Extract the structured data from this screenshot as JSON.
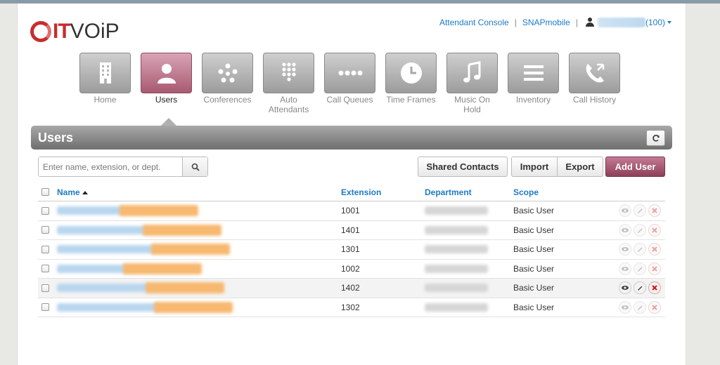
{
  "header": {
    "logo_it": "IT",
    "logo_voip": "VOiP",
    "links": {
      "attendant_console": "Attendant Console",
      "separator": "|",
      "snapmobile": "SNAPmobile",
      "user_ext": "(100)"
    }
  },
  "nav": {
    "items": [
      {
        "label": "Home",
        "icon": "building-icon"
      },
      {
        "label": "Users",
        "icon": "user-icon",
        "active": true
      },
      {
        "label": "Conferences",
        "icon": "dots-circle-icon"
      },
      {
        "label": "Auto Attendants",
        "icon": "keypad-icon"
      },
      {
        "label": "Call Queues",
        "icon": "dots-row-icon"
      },
      {
        "label": "Time Frames",
        "icon": "clock-icon"
      },
      {
        "label": "Music On Hold",
        "icon": "music-note-icon"
      },
      {
        "label": "Inventory",
        "icon": "list-icon"
      },
      {
        "label": "Call History",
        "icon": "phone-arrows-icon"
      }
    ]
  },
  "panel": {
    "title": "Users"
  },
  "toolbar": {
    "search_placeholder": "Enter name, extension, or dept.",
    "shared_contacts": "Shared Contacts",
    "import": "Import",
    "export": "Export",
    "add_user": "Add User"
  },
  "table": {
    "columns": {
      "name": "Name",
      "extension": "Extension",
      "department": "Department",
      "scope": "Scope"
    },
    "rows": [
      {
        "extension": "1001",
        "scope": "Basic User"
      },
      {
        "extension": "1401",
        "scope": "Basic User"
      },
      {
        "extension": "1301",
        "scope": "Basic User"
      },
      {
        "extension": "1002",
        "scope": "Basic User"
      },
      {
        "extension": "1402",
        "scope": "Basic User"
      },
      {
        "extension": "1302",
        "scope": "Basic User"
      }
    ]
  },
  "colors": {
    "accent_link": "#1e7bc6",
    "brand_red": "#c62d2d",
    "active_nav": "#a85a72",
    "add_button": "#8d3f59"
  }
}
